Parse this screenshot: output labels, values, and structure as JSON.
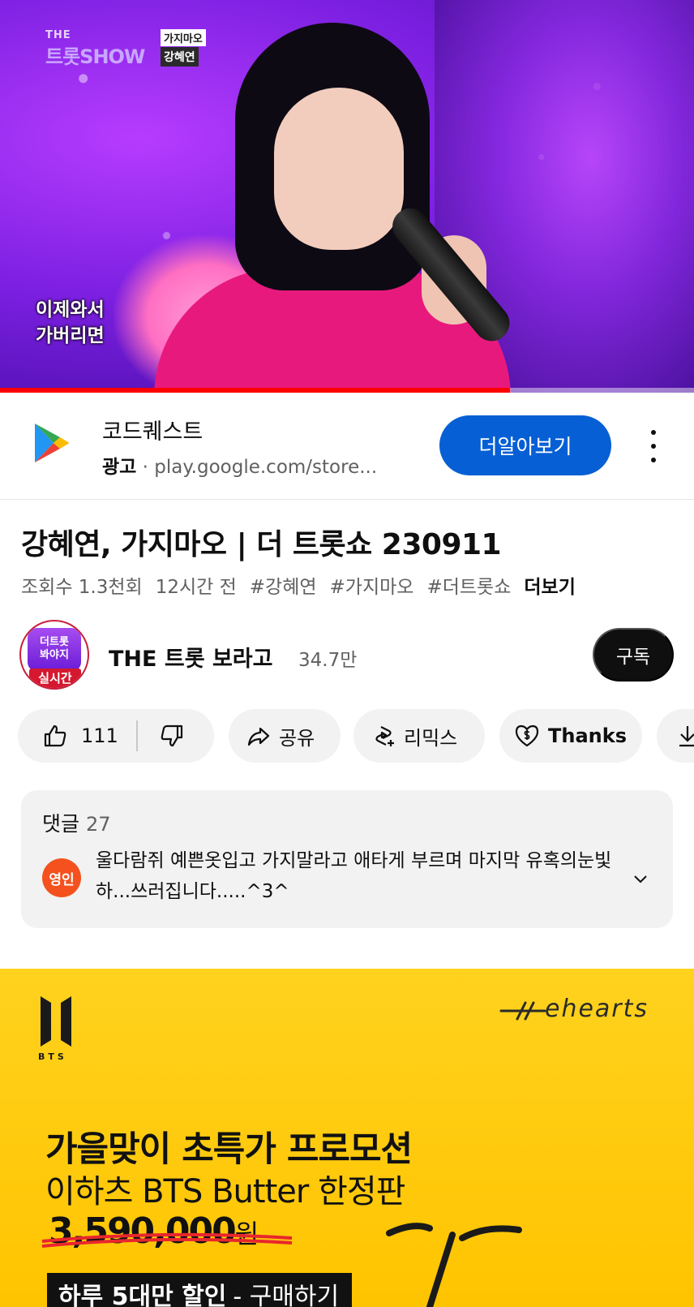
{
  "video": {
    "logo_the": "THE",
    "logo_show": "트롯SHOW",
    "song_tag": "가지마오",
    "singer_tag": "강혜연",
    "lyrics": "이제와서\n가버리면",
    "progress": 0.735
  },
  "ad": {
    "title": "코드퀘스트",
    "label": "광고",
    "separator": "·",
    "url": "play.google.com/store...",
    "cta": "더알아보기",
    "icon": "google-play-icon"
  },
  "video_info": {
    "title": "강혜연, 가지마오 | 더 트롯쇼 230911",
    "views": "조회수 1.3천회",
    "age": "12시간 전",
    "tags": [
      "#강혜연",
      "#가지마오",
      "#더트롯쇼"
    ],
    "more": "더보기"
  },
  "channel": {
    "avatar_text": "더트롯\n봐야지",
    "avatar_badge": "실시간",
    "name": "THE 트롯 보라고",
    "subscribers": "34.7만",
    "subscribe_label": "구독"
  },
  "actions": {
    "likes": "111",
    "share": "공유",
    "remix": "리믹스",
    "thanks": "Thanks"
  },
  "comments": {
    "header": "댓글",
    "count": "27",
    "top_avatar": "영인",
    "top_text": "울다람쥐 예쁜옷입고 가지말라고 애타게 부르며 마지막 유혹의눈빛 하...쓰러집니다.....^3^"
  },
  "banner": {
    "bts": "BTS",
    "brand": "ehearts",
    "headline": "가을맞이 초특가 프로모션",
    "subhead": "이하츠 BTS Butter 한정판",
    "price": "3,590,000",
    "price_unit": "원",
    "buy_bold": "하루 5대만 할인",
    "buy_light": "- 구매하기"
  },
  "colors": {
    "accent_blue": "#065fd4",
    "progress_red": "#ff0000",
    "banner_yellow": "#ffc400"
  }
}
